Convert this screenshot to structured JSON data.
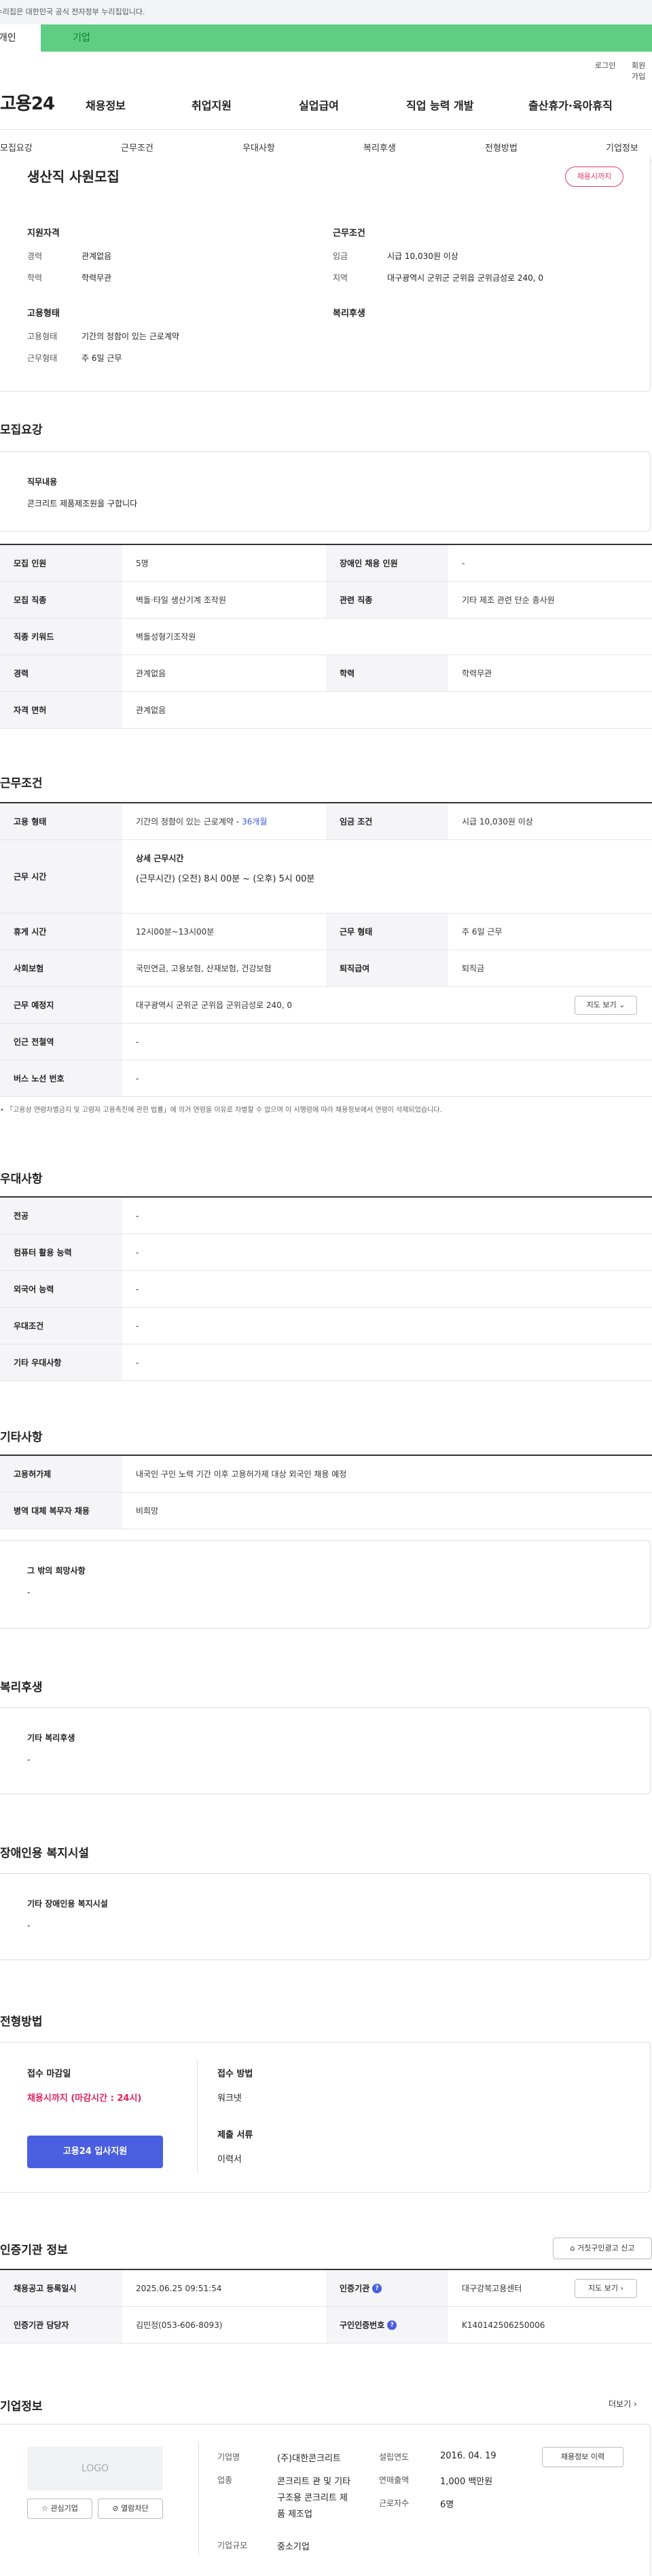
{
  "top_notice": "이 누리집은 대한민국 공식 전자정부 누리집입니다.",
  "user_tabs": {
    "person": "개인",
    "corp": "기업"
  },
  "util": {
    "login": "로그인",
    "join": "회원가입"
  },
  "logo": "고용24",
  "gnb": [
    "채용정보",
    "취업지원",
    "실업급여",
    "직업 능력 개발",
    "출산휴가·육아휴직"
  ],
  "snb": [
    "모집요강",
    "근무조건",
    "우대사항",
    "복리후생",
    "전형방법",
    "기업정보"
  ],
  "job": {
    "title": "생산직 사원모집",
    "badge": "채용시까지",
    "qual_heading": "지원자격",
    "career_label": "경력",
    "career": "관계없음",
    "edu_label": "학력",
    "edu": "학력무관",
    "cond_heading": "근무조건",
    "wage_label": "임금",
    "wage": "시급 10,030원 이상",
    "area_label": "지역",
    "area": "대구광역시 군위군 군위읍 군위금성로 240, 0",
    "emp_heading": "고용형태",
    "emp_label": "고용형태",
    "emp": "기간의 정함이 있는 근로계약",
    "worktype_label": "근무형태",
    "worktype": "주 6일 근무",
    "welfare_heading": "복리후생"
  },
  "recruit": {
    "heading": "모집요강",
    "duty_label": "직무내용",
    "duty": "콘크리트 제품제조원을 구합니다",
    "rows": {
      "count_l": "모집 인원",
      "count": "5명",
      "disabled_l": "장애인 채용 인원",
      "disabled": "-",
      "job_l": "모집 직종",
      "job": "벽돌·타일 생산기계 조작원",
      "rel_l": "관련 직종",
      "rel": "기타 제조 관련 단순 종사원",
      "kw_l": "직종 키워드",
      "kw": "벽돌성형기조작원",
      "career_l": "경력",
      "career": "관계없음",
      "edu_l": "학력",
      "edu": "학력무관",
      "lic_l": "자격 면허",
      "lic": "관계없음"
    }
  },
  "work": {
    "heading": "근무조건",
    "emp_l": "고용 형태",
    "emp": "기간의 정함이 있는 근로계약 - ",
    "emp_months": "36개월",
    "wage_l": "임금 조건",
    "wage": "시급 10,030원 이상",
    "time_l": "근무 시간",
    "time_title": "상세 근무시간",
    "time": "(근무시간) (오전) 8시 00분 ~ (오후) 5시 00분",
    "rest_l": "휴게 시간",
    "rest": "12시00분~13시00분",
    "form_l": "근무 형태",
    "form": "주 6일 근무",
    "ins_l": "사회보험",
    "ins": "국민연금, 고용보험, 산재보험, 건강보험",
    "sev_l": "퇴직급여",
    "sev": "퇴직금",
    "place_l": "근무 예정지",
    "place": "대구광역시 군위군 군위읍 군위금성로 240, 0",
    "map_btn": "지도 보기",
    "sub_l": "인근 전철역",
    "sub": "-",
    "bus_l": "버스 노선 번호",
    "bus": "-",
    "note": "「고용상 연령차별금지 및 고령자 고용촉진에 관한 법률」에 의거 연령을 이유로 차별할 수 없으며 이 시행령에 따라 채용정보에서 연령이 삭제되었습니다."
  },
  "pref": {
    "heading": "우대사항",
    "major_l": "전공",
    "major": "-",
    "pc_l": "컴퓨터 활용 능력",
    "pc": "-",
    "lang_l": "외국어 능력",
    "lang": "-",
    "cond_l": "우대조건",
    "cond": "-",
    "etc_l": "기타 우대사항",
    "etc": "-"
  },
  "other": {
    "heading": "기타사항",
    "permit_l": "고용허가제",
    "permit": "내국인 구인 노력 기간 이후 고용허가제 대상 외국인 채용 예정",
    "mil_l": "병역 대체 복무자 채용",
    "mil": "비희망",
    "wish_l": "그 밖의 희망사항",
    "wish": "-"
  },
  "welfare": {
    "heading": "복리후생",
    "etc_l": "기타 복리후생",
    "etc": "-"
  },
  "facility": {
    "heading": "장애인용 복지시설",
    "etc_l": "기타 장애인용 복지시설",
    "etc": "-"
  },
  "screen": {
    "heading": "전형방법",
    "deadline_l": "접수 마감일",
    "deadline": "채용시까지 (마감시간 : 24시)",
    "apply_btn": "고용24 입사지원",
    "method_l": "접수 방법",
    "method": "워크넷",
    "docs_l": "제출 서류",
    "docs": "이력서"
  },
  "cert": {
    "heading": "인증기관 정보",
    "report_btn": "거짓구인광고 신고",
    "reg_l": "채용공고 등록일시",
    "reg": "2025.06.25 09:51:54",
    "org_l": "인증기관",
    "org": "대구강북고용센터",
    "map_btn": "지도 보기",
    "mgr_l": "인증기관 담당자",
    "mgr": "김민정(053-606-8093)",
    "no_l": "구인인증번호",
    "no": "K140142506250006"
  },
  "company": {
    "heading": "기업정보",
    "more": "더보기",
    "logo": "LOGO",
    "fav_btn": "관심기업",
    "block_btn": "열람차단",
    "name_l": "기업명",
    "name": "(주)대한콘크리트",
    "biz_l": "업종",
    "biz": "콘크리트 관 및 기타 구조용 콘크리트 제품 제조업",
    "size_l": "기업규모",
    "size": "중소기업",
    "est_l": "설립연도",
    "est": "2016. 04. 19",
    "sales_l": "연매출액",
    "sales": "1,000 백만원",
    "emp_l": "근로자수",
    "emp": "6명",
    "history_btn": "채용정보 이력"
  }
}
